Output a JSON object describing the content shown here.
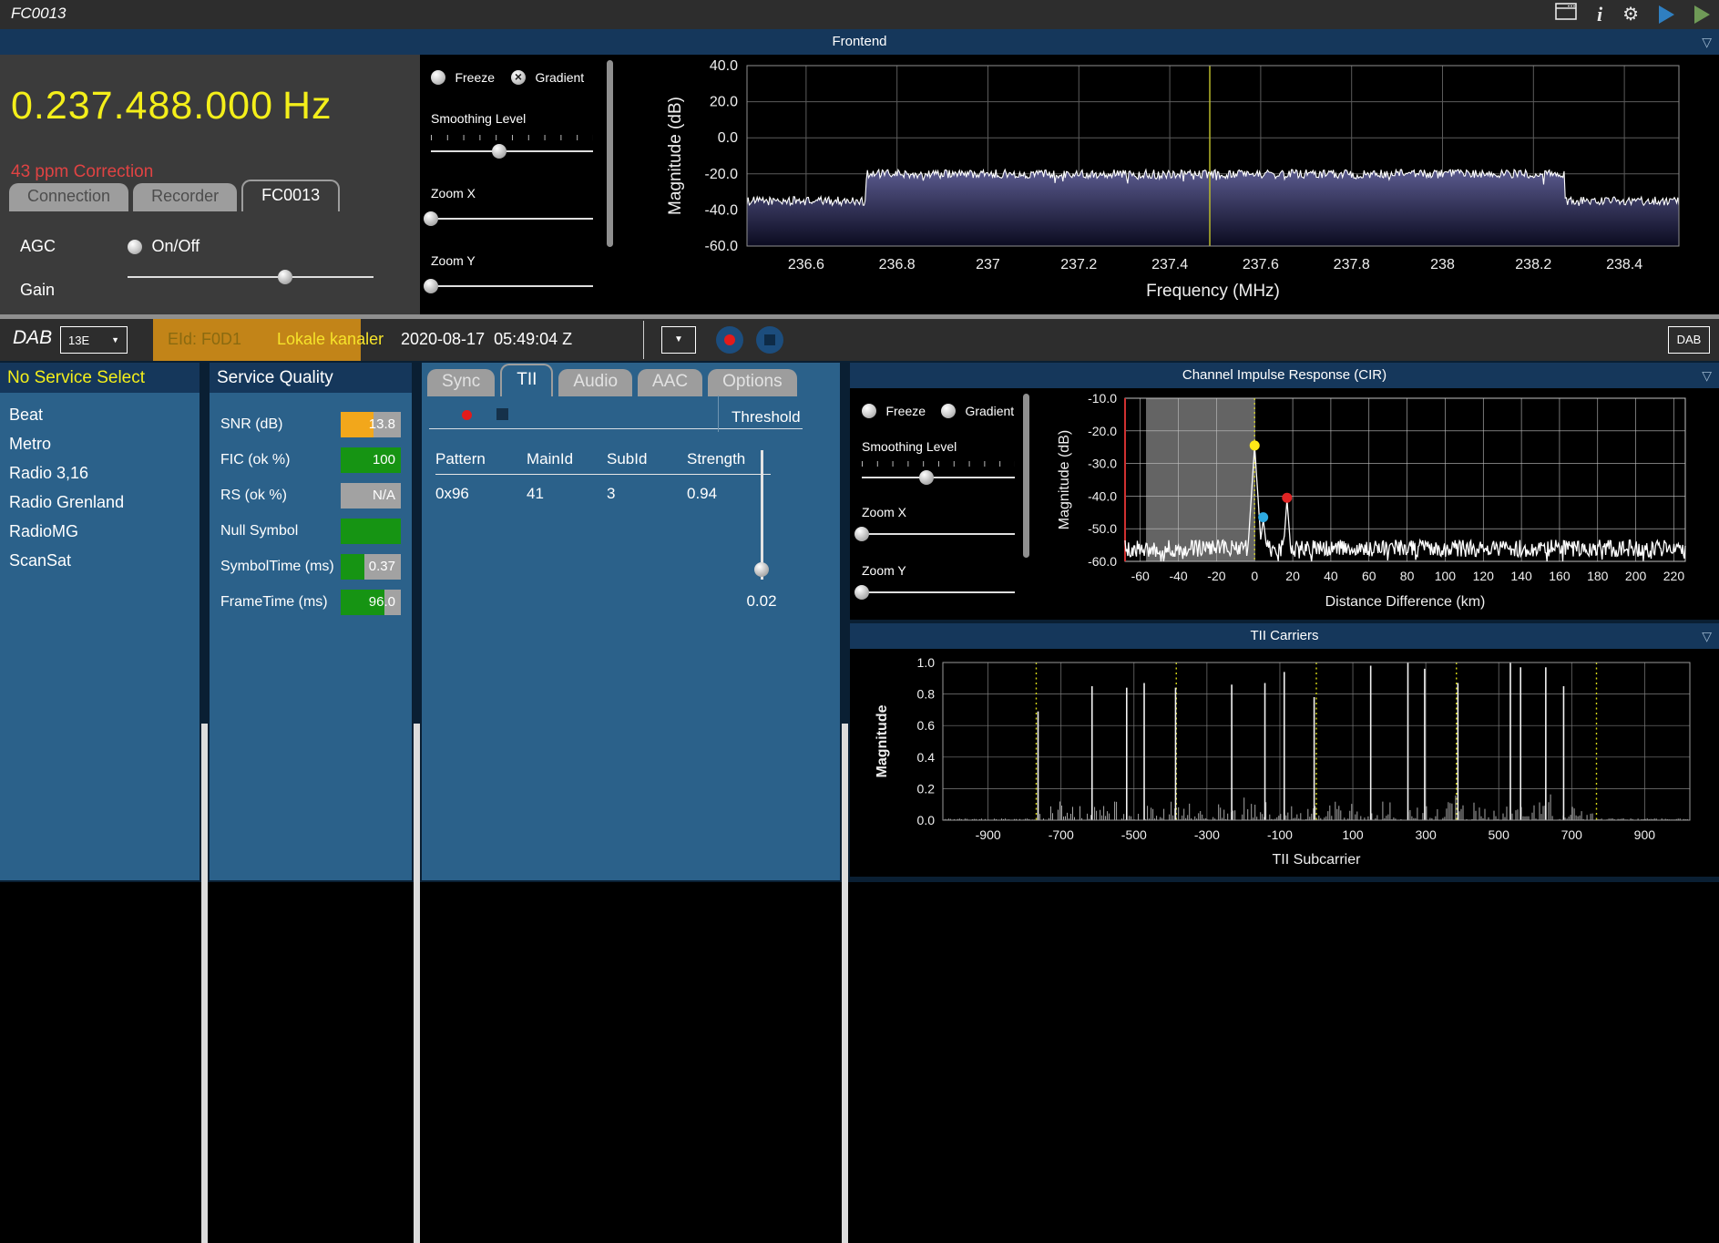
{
  "colors": {
    "titlebar_bg": "#2d2d2d",
    "navy_header": "#15375b",
    "page_navy": "#0a1f33",
    "panel_gray": "#3b3b3b",
    "steel_blue": "#2b618a",
    "orange_highlight": "#c28418",
    "eid_text": "#8a6a10",
    "ensemble_yellow": "#f6e32a",
    "freq_yellow": "#f4ef1a",
    "correction_red": "#e04343",
    "bar_orange": "#f2a71b",
    "bar_green": "#169413",
    "bar_gray": "#a2a2a2",
    "record_red": "#e31b1b",
    "record_btn_bg": "#1c4d7d",
    "tab_gray": "#9d9d9d",
    "splitter": "#dcdcdc"
  },
  "title_bar": {
    "title": "FC0013"
  },
  "frontend": {
    "header": "Frontend",
    "frequency": "0.237.488.000",
    "frequency_unit": "Hz",
    "correction": "43 ppm Correction",
    "tabs": [
      "Connection",
      "Recorder",
      "FC0013"
    ],
    "active_tab": "FC0013",
    "agc_label": "AGC",
    "agc_option": "On/Off",
    "gain_label": "Gain",
    "gain_pct": 64,
    "controls": {
      "freeze": "Freeze",
      "gradient": "Gradient",
      "gradient_checked": true,
      "smoothing": "Smoothing Level",
      "smoothing_pct": 42,
      "zoomx": "Zoom X",
      "zoomx_pct": 0,
      "zoomy": "Zoom Y",
      "zoomy_pct": 0
    }
  },
  "dab_bar": {
    "label": "DAB",
    "channel": "13E",
    "eid": "EId: F0D1",
    "ensemble": "Lokale kanaler",
    "timestamp": "2020-08-17  05:49:04 Z",
    "right_tab": "DAB"
  },
  "services": {
    "header": "No Service Select",
    "items": [
      "Beat",
      "Metro",
      "Radio 3,16",
      "Radio Grenland",
      "RadioMG",
      "ScanSat"
    ]
  },
  "service_quality": {
    "header": "Service Quality",
    "rows": [
      {
        "label": "SNR (dB)",
        "value": "13.8",
        "fill_pct": 55,
        "fill_color": "#f2a71b"
      },
      {
        "label": "FIC (ok %)",
        "value": "100",
        "fill_pct": 100,
        "fill_color": "#169413"
      },
      {
        "label": "RS (ok %)",
        "value": "N/A",
        "fill_pct": 0,
        "fill_color": "#169413"
      },
      {
        "label": "Null Symbol",
        "value": "",
        "fill_pct": 100,
        "fill_color": "#169413"
      },
      {
        "label": "SymbolTime (ms)",
        "value": "0.37",
        "fill_pct": 40,
        "fill_color": "#169413"
      },
      {
        "label": "FrameTime (ms)",
        "value": "96.0",
        "fill_pct": 73,
        "fill_color": "#169413"
      }
    ]
  },
  "tii_panel": {
    "tabs": [
      "Sync",
      "TII",
      "Audio",
      "AAC",
      "Options"
    ],
    "active_tab": "TII",
    "table": {
      "headers": [
        "Pattern",
        "MainId",
        "SubId",
        "Strength"
      ],
      "rows": [
        [
          "0x96",
          "41",
          "3",
          "0.94"
        ]
      ]
    },
    "threshold_label": "Threshold",
    "threshold_value": "0.02",
    "threshold_handle_pct": 92
  },
  "cir_panel": {
    "header": "Channel Impulse Response (CIR)",
    "controls": {
      "freeze": "Freeze",
      "gradient": "Gradient",
      "smoothing": "Smoothing Level",
      "smoothing_pct": 42,
      "zoomx": "Zoom X",
      "zoomx_pct": 0,
      "zoomy": "Zoom Y",
      "zoomy_pct": 0
    }
  },
  "tii_carriers": {
    "header": "TII Carriers"
  },
  "chart_data": [
    {
      "id": "frontend_spectrum",
      "type": "area",
      "title": "Frontend spectrum",
      "xlabel": "Frequency (MHz)",
      "ylabel": "Magnitude (dB)",
      "xlim": [
        236.47,
        238.52
      ],
      "ylim": [
        -60,
        40
      ],
      "xticks": [
        236.6,
        236.8,
        237,
        237.2,
        237.4,
        237.6,
        237.8,
        238,
        238.2,
        238.4
      ],
      "yticks": [
        40,
        20,
        0,
        -20,
        -40,
        -60
      ],
      "grid": true,
      "legend": false,
      "noise_floor_db": -35,
      "plateau_db": -20,
      "plateau_start_mhz": 236.73,
      "plateau_end_mhz": 238.27,
      "noise_amp_db": 2.4,
      "tuned_marker_mhz": 237.488,
      "marker_color": "#b9b92a",
      "line_color": "#ffffff",
      "fill_top": "#5a5a8e",
      "fill_bottom": "#0b0b20"
    },
    {
      "id": "cir",
      "type": "line",
      "title": "Channel Impulse Response (CIR)",
      "xlabel": "Distance Difference (km)",
      "ylabel": "Magnitude (dB)",
      "xlim": [
        -68,
        226
      ],
      "ylim": [
        -60,
        -10
      ],
      "xticks": [
        -60,
        -40,
        -20,
        0,
        20,
        40,
        60,
        80,
        100,
        120,
        140,
        160,
        180,
        200,
        220
      ],
      "yticks": [
        -10,
        -20,
        -30,
        -40,
        -50,
        -60
      ],
      "grid": true,
      "legend": false,
      "noise_floor_db": -56,
      "noise_amp_db": 2.6,
      "peaks": [
        {
          "x_km": 0,
          "db": -24.5
        },
        {
          "x_km": 4.5,
          "db": -47
        },
        {
          "x_km": 17,
          "db": -41
        }
      ],
      "markers": [
        {
          "x_km": 0,
          "db": -24.5,
          "color": "#ffe818"
        },
        {
          "x_km": 4.5,
          "db": -46.5,
          "color": "#2da9e1"
        },
        {
          "x_km": 17,
          "db": -40.5,
          "color": "#e02424"
        }
      ],
      "shaded_region_km": [
        -57,
        0
      ],
      "guide_line_km": 0,
      "guide_color": "#e6e630"
    },
    {
      "id": "tii_carriers",
      "type": "bar",
      "title": "TII Carriers",
      "xlabel": "TII Subcarrier",
      "ylabel": "Magnitude",
      "xlim": [
        -1024,
        1024
      ],
      "ylim": [
        0,
        1
      ],
      "xticks": [
        -900,
        -700,
        -500,
        -300,
        -100,
        100,
        300,
        500,
        700,
        900
      ],
      "yticks": [
        0,
        0.2,
        0.4,
        0.6,
        0.8,
        1
      ],
      "grid": true,
      "legend": false,
      "block_boundaries": [
        -768,
        -384,
        0,
        384,
        768
      ],
      "boundary_color": "#d6d614",
      "carriers": [
        {
          "x": -763,
          "h": 0.69
        },
        {
          "x": -615,
          "h": 0.85
        },
        {
          "x": -520,
          "h": 0.84
        },
        {
          "x": -472,
          "h": 0.87
        },
        {
          "x": -386,
          "h": 0.84
        },
        {
          "x": -232,
          "h": 0.86
        },
        {
          "x": -141,
          "h": 0.87
        },
        {
          "x": -88,
          "h": 0.94
        },
        {
          "x": -6,
          "h": 0.78
        },
        {
          "x": 149,
          "h": 0.98
        },
        {
          "x": 251,
          "h": 1.0
        },
        {
          "x": 297,
          "h": 0.96
        },
        {
          "x": 388,
          "h": 0.87
        },
        {
          "x": 532,
          "h": 1.0
        },
        {
          "x": 560,
          "h": 0.97
        },
        {
          "x": 629,
          "h": 0.97
        },
        {
          "x": 678,
          "h": 0.85
        }
      ]
    }
  ]
}
